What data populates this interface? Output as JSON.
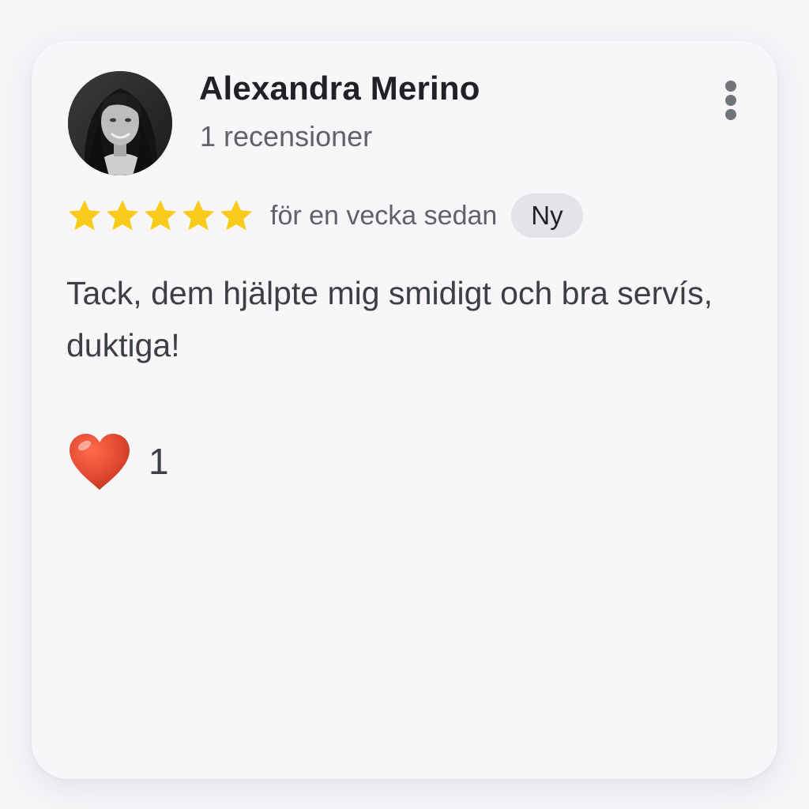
{
  "review": {
    "reviewer_name": "Alexandra Merino",
    "review_count": "1 recensioner",
    "rating": 5,
    "time_ago": "för en vecka sedan",
    "badge": "Ny",
    "text": "Tack, dem hjälpte mig smidigt och bra servís, duktiga!",
    "reaction_count": "1"
  },
  "icons": {
    "menu": "more-vert-icon",
    "star": "star-icon",
    "reaction": "heart-icon"
  },
  "colors": {
    "star": "#f9cb1b",
    "heart": "#e0492f",
    "badge_bg": "#e4e3e8"
  }
}
